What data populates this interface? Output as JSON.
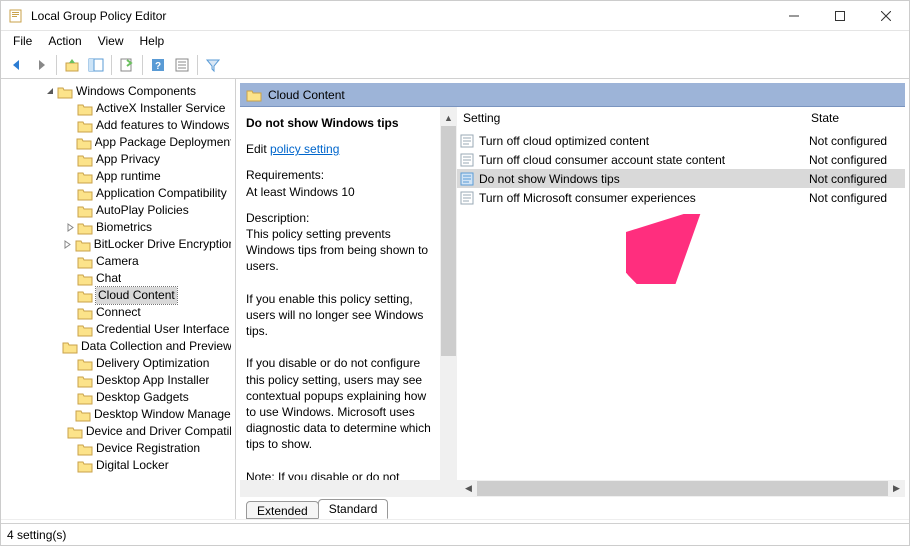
{
  "titlebar": {
    "title": "Local Group Policy Editor"
  },
  "menubar": {
    "file": "File",
    "action": "Action",
    "view": "View",
    "help": "Help"
  },
  "tree": {
    "parent": "Windows Components",
    "items": [
      {
        "label": "ActiveX Installer Service",
        "expandable": false
      },
      {
        "label": "Add features to Windows",
        "expandable": false
      },
      {
        "label": "App Package Deployment",
        "expandable": false
      },
      {
        "label": "App Privacy",
        "expandable": false
      },
      {
        "label": "App runtime",
        "expandable": false
      },
      {
        "label": "Application Compatibility",
        "expandable": false
      },
      {
        "label": "AutoPlay Policies",
        "expandable": false
      },
      {
        "label": "Biometrics",
        "expandable": true
      },
      {
        "label": "BitLocker Drive Encryption",
        "expandable": true
      },
      {
        "label": "Camera",
        "expandable": false
      },
      {
        "label": "Chat",
        "expandable": false
      },
      {
        "label": "Cloud Content",
        "expandable": false,
        "selected": true
      },
      {
        "label": "Connect",
        "expandable": false
      },
      {
        "label": "Credential User Interface",
        "expandable": false
      },
      {
        "label": "Data Collection and Preview Builds",
        "expandable": false
      },
      {
        "label": "Delivery Optimization",
        "expandable": false
      },
      {
        "label": "Desktop App Installer",
        "expandable": false
      },
      {
        "label": "Desktop Gadgets",
        "expandable": false
      },
      {
        "label": "Desktop Window Manager",
        "expandable": false
      },
      {
        "label": "Device and Driver Compatibility",
        "expandable": false
      },
      {
        "label": "Device Registration",
        "expandable": false
      },
      {
        "label": "Digital Locker",
        "expandable": false
      }
    ]
  },
  "category": {
    "title": "Cloud Content"
  },
  "description": {
    "name": "Do not show Windows tips",
    "edit_prefix": "Edit",
    "edit_link": "policy setting",
    "req_label": "Requirements:",
    "req_text": "At least Windows 10",
    "desc_label": "Description:",
    "desc_text1": "This policy setting prevents Windows tips from being shown to users.",
    "desc_text2": "If you enable this policy setting, users will no longer see Windows tips.",
    "desc_text3": "If you disable or do not configure this policy setting, users may see contextual popups explaining how to use Windows. Microsoft uses diagnostic data to determine which tips to show.",
    "desc_text4": "Note: If you disable or do not configure this policy setting, but enable the \"Computer"
  },
  "list": {
    "col_setting": "Setting",
    "col_state": "State",
    "rows": [
      {
        "label": "Turn off cloud optimized content",
        "state": "Not configured",
        "selected": false
      },
      {
        "label": "Turn off cloud consumer account state content",
        "state": "Not configured",
        "selected": false
      },
      {
        "label": "Do not show Windows tips",
        "state": "Not configured",
        "selected": true
      },
      {
        "label": "Turn off Microsoft consumer experiences",
        "state": "Not configured",
        "selected": false
      }
    ]
  },
  "tabs": {
    "extended": "Extended",
    "standard": "Standard"
  },
  "statusbar": {
    "text": "4 setting(s)"
  }
}
